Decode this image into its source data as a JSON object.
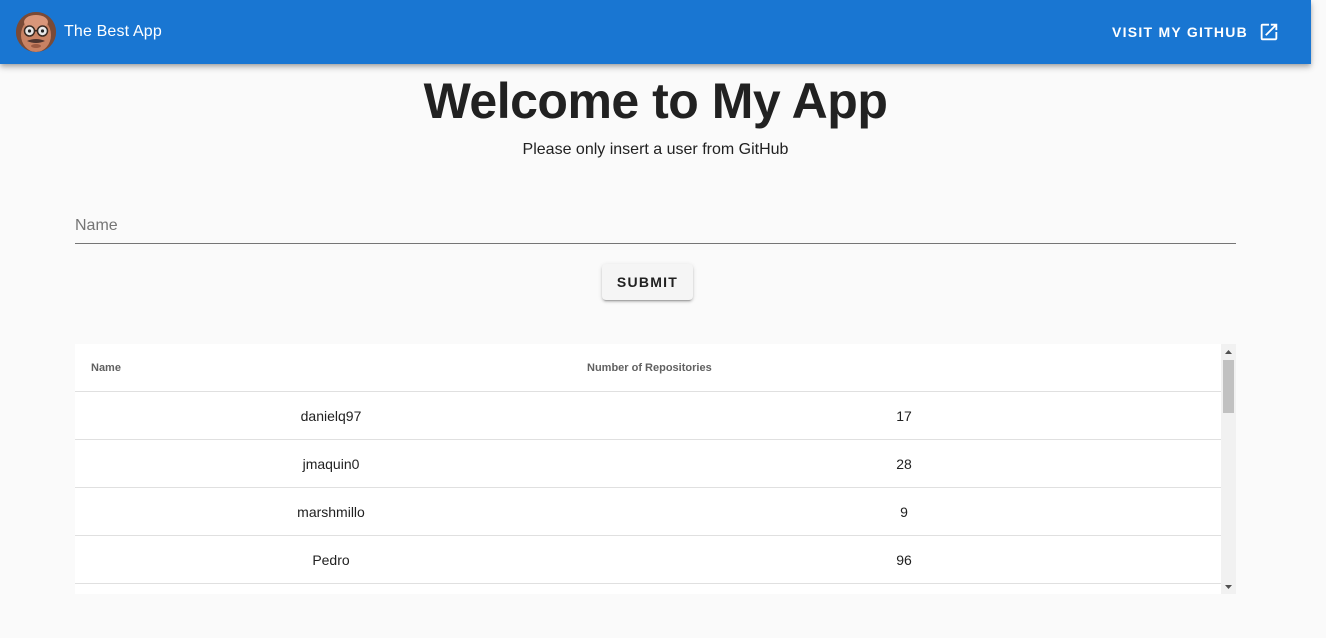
{
  "appbar": {
    "title": "The Best App",
    "github_label": "VISIT MY GITHUB",
    "color": "#1976d2"
  },
  "main": {
    "title": "Welcome to My App",
    "subtitle": "Please only insert a user from GitHub",
    "name_placeholder": "Name",
    "name_value": "",
    "submit_label": "SUBMIT"
  },
  "table": {
    "headers": [
      "Name",
      "Number of Repositories"
    ],
    "rows": [
      {
        "name": "danielq97",
        "repos": "17"
      },
      {
        "name": "jmaquin0",
        "repos": "28"
      },
      {
        "name": "marshmillo",
        "repos": "9"
      },
      {
        "name": "Pedro",
        "repos": "96"
      }
    ]
  }
}
